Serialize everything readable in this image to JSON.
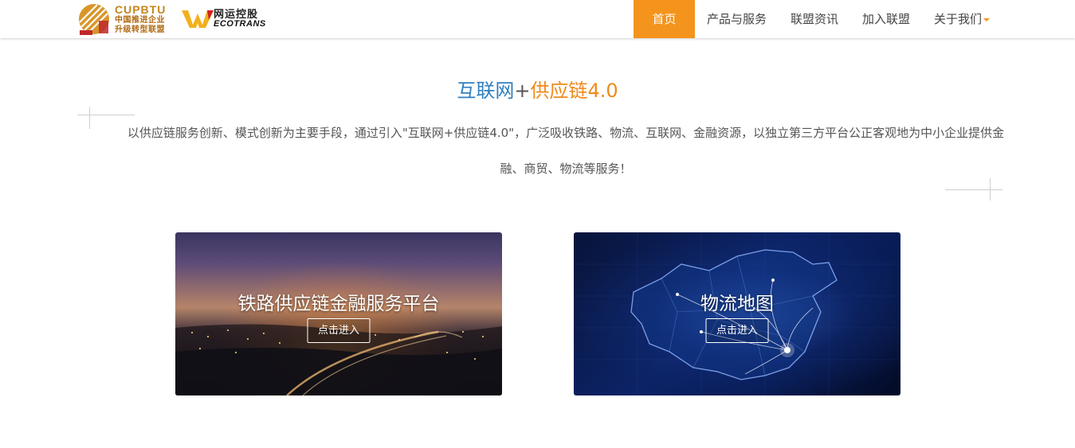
{
  "header": {
    "logo_cupbtu": {
      "en": "CUPBTU",
      "cn_line1": "中国推进企业",
      "cn_line2": "升级转型联盟"
    },
    "logo_ecotrans": {
      "cn": "网运控股",
      "en": "ECOTRANS"
    },
    "nav": [
      {
        "label": "首页",
        "active": true
      },
      {
        "label": "产品与服务",
        "active": false
      },
      {
        "label": "联盟资讯",
        "active": false
      },
      {
        "label": "加入联盟",
        "active": false
      },
      {
        "label": "关于我们",
        "active": false,
        "has_dropdown": true
      }
    ]
  },
  "intro": {
    "title_part1": "互联网",
    "title_plus": "+",
    "title_part2": "供应链4.0",
    "description": "以供应链服务创新、模式创新为主要手段，通过引入\"互联网+供应链4.0\"，广泛吸收铁路、物流、互联网、金融资源，以独立第三方平台公正客观地为中小企业提供金融、商贸、物流等服务！"
  },
  "cards": [
    {
      "title": "铁路供应链金融服务平台",
      "button": "点击进入"
    },
    {
      "title": "物流地图",
      "button": "点击进入"
    }
  ],
  "colors": {
    "accent_orange": "#f4941c",
    "title_blue": "#2f7fc0",
    "title_orange": "#f08a1c"
  }
}
